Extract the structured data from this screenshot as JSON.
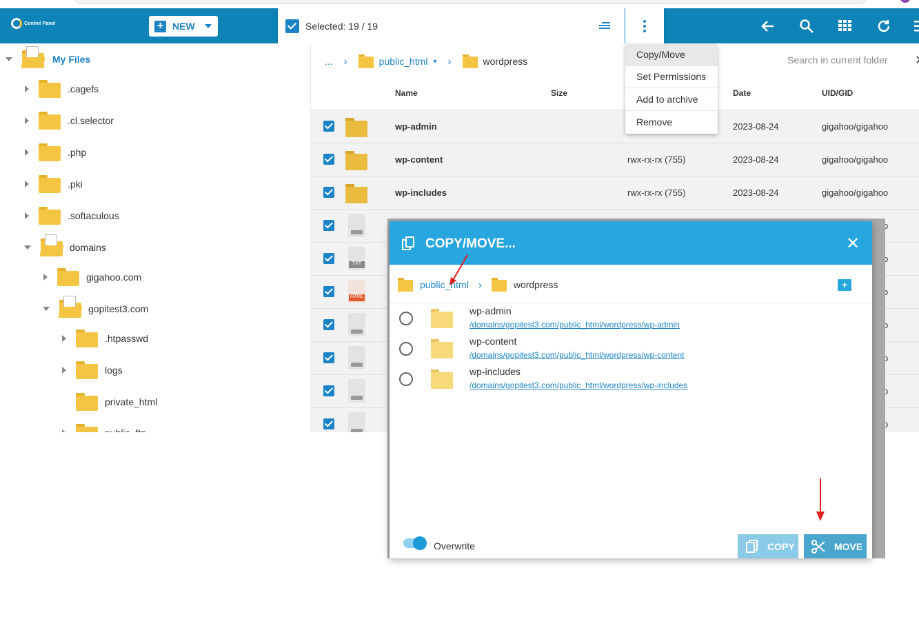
{
  "app": {
    "logo_text": "Control Panel"
  },
  "toolbar": {
    "new_label": "NEW",
    "selected_text": "Selected: 19 / 19"
  },
  "colors": {
    "brand": "#0e83b8",
    "accent": "#1c84c6",
    "modal_header": "#27a6df",
    "folder": "#f4c542"
  },
  "icons": [
    "back-arrow-icon",
    "search-icon",
    "grid-icon",
    "refresh-icon",
    "menu-icon"
  ],
  "sidebar": {
    "root_label": "My Files",
    "items": [
      {
        "label": ".cagefs"
      },
      {
        "label": ".cl.selector"
      },
      {
        "label": ".php"
      },
      {
        "label": ".pki"
      },
      {
        "label": ".softaculous"
      },
      {
        "label": "domains"
      },
      {
        "label": "gigahoo.com"
      },
      {
        "label": "gopitest3.com"
      },
      {
        "label": ".htpasswd"
      },
      {
        "label": "logs"
      },
      {
        "label": "private_html"
      },
      {
        "label": "public_ftp"
      }
    ]
  },
  "breadcrumb": {
    "ellipsis": "...",
    "parent": "public_html",
    "current": "wordpress"
  },
  "search": {
    "placeholder": "Search in current folder"
  },
  "table": {
    "headers": {
      "name": "Name",
      "size": "Size",
      "date": "Date",
      "uid": "UID/GID"
    },
    "rows": [
      {
        "name": "wp-admin",
        "perm": "",
        "date": "2023-08-24",
        "uid": "gigahoo/gigahoo"
      },
      {
        "name": "wp-content",
        "perm": "rwx-rx-rx (755)",
        "date": "2023-08-24",
        "uid": "gigahoo/gigahoo"
      },
      {
        "name": "wp-includes",
        "perm": "rwx-rx-rx (755)",
        "date": "2023-08-24",
        "uid": "gigahoo/gigahoo"
      }
    ],
    "file_tags": [
      "TXT",
      "HTML"
    ],
    "ghost_suffix": "o"
  },
  "context_menu": {
    "items": [
      "Copy/Move",
      "Set Permissions",
      "Add to archive",
      "Remove"
    ]
  },
  "modal": {
    "title": "COPY/MOVE...",
    "crumb_parent": "public_html",
    "crumb_current": "wordpress",
    "items": [
      {
        "name": "wp-admin",
        "path": "/domains/gopitest3.com/public_html/wordpress/wp-admin"
      },
      {
        "name": "wp-content",
        "path": "/domains/gopitest3.com/public_html/wordpress/wp-content"
      },
      {
        "name": "wp-includes",
        "path": "/domains/gopitest3.com/public_html/wordpress/wp-includes"
      }
    ],
    "overwrite_label": "Overwrite",
    "overwrite_on": true,
    "copy_label": "COPY",
    "move_label": "MOVE"
  }
}
